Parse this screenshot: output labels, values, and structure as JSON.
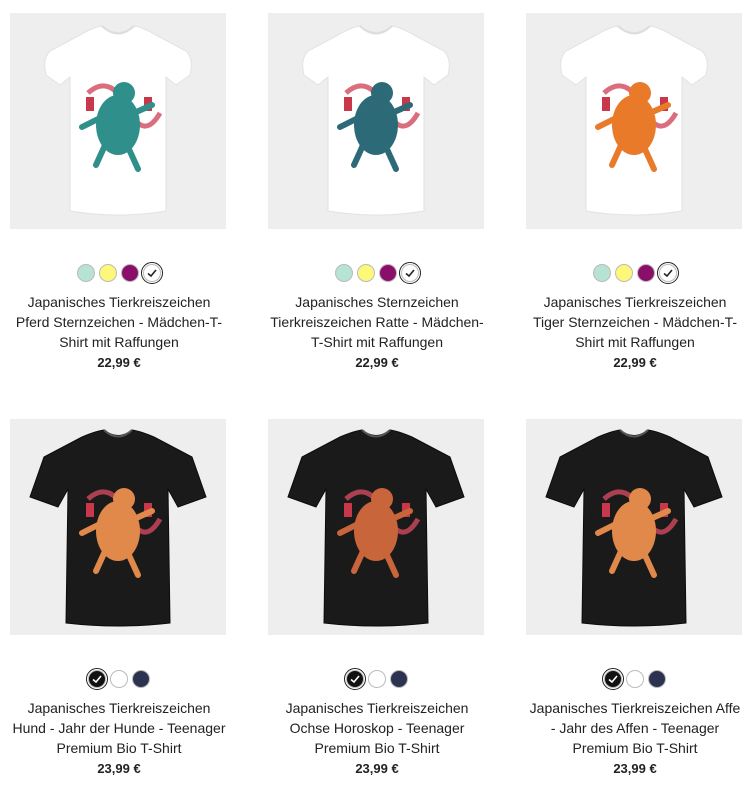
{
  "products": [
    {
      "title": "Japanisches Tierkreiszeichen Pferd Sternzeichen - Mädchen-T-Shirt mit Raffungen",
      "price": "22,99 €",
      "shirt_color": "#ffffff",
      "print": "horse",
      "print_color": "#2f8f8b",
      "swatches": [
        "#b6e3d4",
        "#fdf77a",
        "#8a0f6b",
        "#ffffff"
      ],
      "selected": 3
    },
    {
      "title": "Japanisches Sternzeichen Tierkreiszeichen Ratte - Mädchen-T-Shirt mit Raffungen",
      "price": "22,99 €",
      "shirt_color": "#ffffff",
      "print": "rat",
      "print_color": "#2d6a78",
      "swatches": [
        "#b6e3d4",
        "#fdf77a",
        "#8a0f6b",
        "#ffffff"
      ],
      "selected": 3
    },
    {
      "title": "Japanisches Tierkreiszeichen Tiger Sternzeichen - Mädchen-T-Shirt mit Raffungen",
      "price": "22,99 €",
      "shirt_color": "#ffffff",
      "print": "tiger",
      "print_color": "#e87a2a",
      "swatches": [
        "#b6e3d4",
        "#fdf77a",
        "#8a0f6b",
        "#ffffff"
      ],
      "selected": 3
    },
    {
      "title": "Japanisches Tierkreiszeichen Hund - Jahr der Hunde - Teenager Premium Bio T-Shirt",
      "price": "23,99 €",
      "shirt_color": "#1a1a1a",
      "print": "dog",
      "print_color": "#e0894a",
      "swatches": [
        "#111111",
        "#ffffff",
        "#2b3350"
      ],
      "selected": 0
    },
    {
      "title": "Japanisches Tierkreiszeichen Ochse Horoskop - Teenager Premium Bio T-Shirt",
      "price": "23,99 €",
      "shirt_color": "#1a1a1a",
      "print": "ox",
      "print_color": "#c8653a",
      "swatches": [
        "#111111",
        "#ffffff",
        "#2b3350"
      ],
      "selected": 0
    },
    {
      "title": "Japanisches Tierkreiszeichen Affe - Jahr des Affen - Teenager Premium Bio T-Shirt",
      "price": "23,99 €",
      "shirt_color": "#1a1a1a",
      "print": "monkey",
      "print_color": "#e0894a",
      "swatches": [
        "#111111",
        "#ffffff",
        "#2b3350"
      ],
      "selected": 0
    }
  ]
}
